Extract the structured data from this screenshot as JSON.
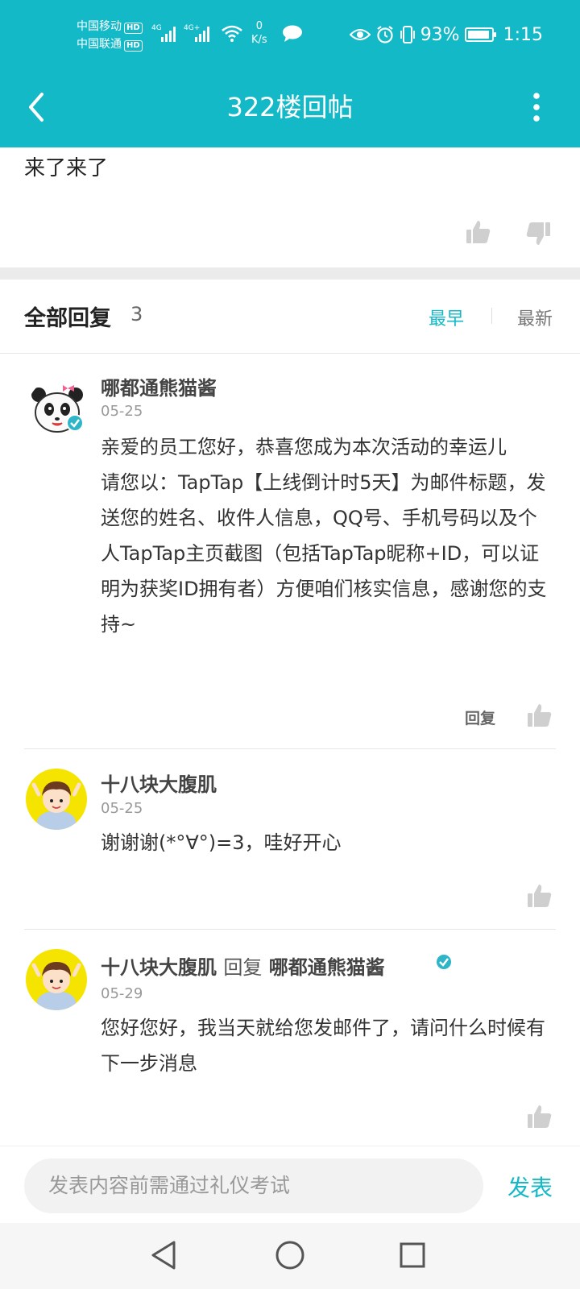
{
  "status_bar": {
    "carrier_1": "中国移动",
    "carrier_2": "中国联通",
    "hd_label": "HD",
    "net_1": "4G",
    "net_2": "4G+",
    "speed_value": "0",
    "speed_unit": "K/s",
    "battery": "93%",
    "battery_level": 0.93,
    "time": "1:15"
  },
  "header": {
    "title": "322楼回帖"
  },
  "post": {
    "text": "来了来了"
  },
  "replies": {
    "title": "全部回复",
    "count": "3",
    "sort_earliest": "最早",
    "sort_latest": "最新",
    "items": [
      {
        "username": "哪都通熊猫酱",
        "date": "05-25",
        "body": "亲爱的员工您好，恭喜您成为本次活动的幸运儿\n请您以：TapTap【上线倒计时5天】为邮件标题，发送您的姓名、收件人信息，QQ号、手机号码以及个人TapTap主页截图（包括TapTap昵称+ID，可以证明为获奖ID拥有者）方便咱们核实信息，感谢您的支持~",
        "reply_label": "回复"
      },
      {
        "username": "十八块大腹肌",
        "date": "05-25",
        "body": "谢谢谢(*°∀°)=3，哇好开心"
      },
      {
        "username": "十八块大腹肌",
        "reply_word": "回复",
        "reply_to": "哪都通熊猫酱",
        "date": "05-29",
        "body": "您好您好，我当天就给您发邮件了，请问什么时候有下一步消息"
      }
    ]
  },
  "input_bar": {
    "placeholder": "发表内容前需通过礼仪考试",
    "send_label": "发表"
  },
  "colors": {
    "accent": "#14b9c8",
    "verified": "#2fb5c8"
  }
}
